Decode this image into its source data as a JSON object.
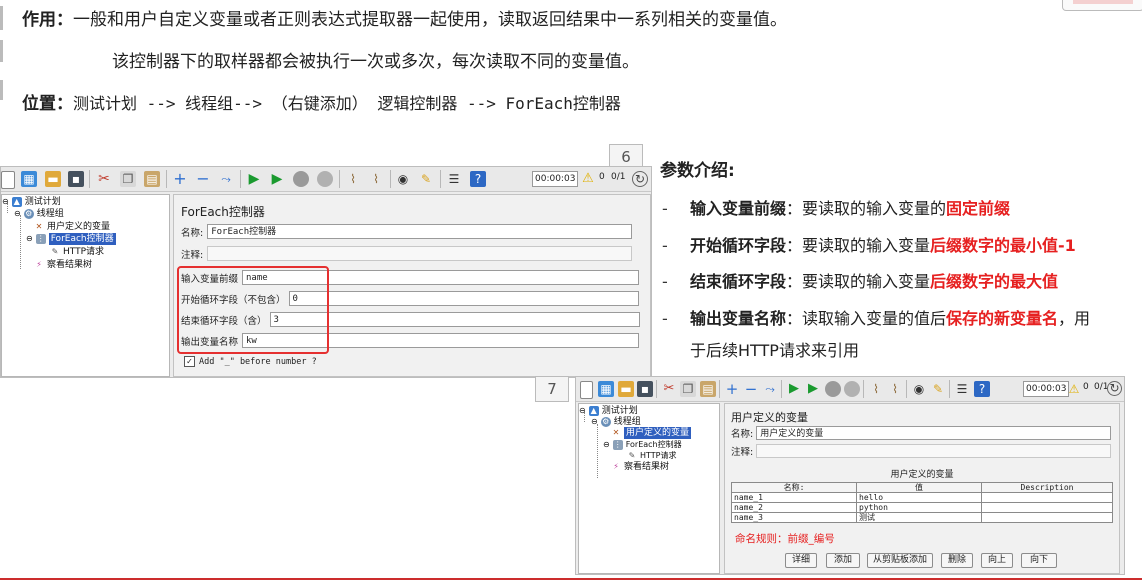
{
  "doc": {
    "purpose_label": "作用",
    "purpose_text": "一般和用户自定义变量或者正则表达式提取器一起使用，读取返回结果中一系列相关的变量值。",
    "purpose_text2": "该控制器下的取样器都会被执行一次或多次，每次读取不同的变量值。",
    "position_label": "位置",
    "position_text": "测试计划 --> 线程组--> （右键添加） 逻辑控制器 -->  ForEach控制器"
  },
  "screenshot6": {
    "tag": "6",
    "timer": "00:00:03",
    "warn_count": "0",
    "threads": "0/1",
    "tree": {
      "test_plan": "测试计划",
      "thread_group": "线程组",
      "user_vars": "用户定义的变量",
      "foreach": "ForEach控制器",
      "http": "HTTP请求",
      "result_tree": "察看结果树"
    },
    "panel": {
      "title": "ForEach控制器",
      "name_label": "名称:",
      "name_value": "ForEach控制器",
      "comment_label": "注释:",
      "input_prefix_label": "输入变量前缀",
      "input_prefix_value": "name",
      "start_label": "开始循环字段（不包含）",
      "start_value": "0",
      "end_label": "结束循环字段（含）",
      "end_value": "3",
      "output_label": "输出变量名称",
      "output_value": "kw",
      "add_label": "Add \"_\" before number ?",
      "add_checked": "✓"
    }
  },
  "params": {
    "heading": "参数介绍:",
    "items": [
      {
        "dash": "-",
        "label": "输入变量前缀",
        "text": "：要读取的输入变量的",
        "highlight": "固定前缀",
        "tail": ""
      },
      {
        "dash": "-",
        "label": "开始循环字段",
        "text": "：要读取的输入变量",
        "highlight": "后缀数字的最小值-1",
        "tail": ""
      },
      {
        "dash": "-",
        "label": "结束循环字段",
        "text": "：要读取的输入变量",
        "highlight": "后缀数字的最大值",
        "tail": ""
      },
      {
        "dash": "-",
        "label": "输出变量名称",
        "text": "：读取输入变量的值后",
        "highlight": "保存的新变量名",
        "tail": "，用"
      }
    ],
    "continuation": "于后续HTTP请求来引用"
  },
  "screenshot7": {
    "tag": "7",
    "timer": "00:00:03",
    "warn_count": "0",
    "threads": "0/1",
    "tree": {
      "test_plan": "测试计划",
      "thread_group": "线程组",
      "user_vars": "用户定义的变量",
      "foreach": "ForEach控制器",
      "http": "HTTP请求",
      "result_tree": "察看结果树"
    },
    "panel": {
      "title": "用户定义的变量",
      "name_label": "名称:",
      "name_value": "用户定义的变量",
      "comment_label": "注释:",
      "table_caption": "用户定义的变量",
      "columns": [
        "名称:",
        "值",
        "Description"
      ],
      "rows": [
        [
          "name_1",
          "hello",
          ""
        ],
        [
          "name_2",
          "python",
          ""
        ],
        [
          "name_3",
          "测试",
          ""
        ]
      ],
      "naming_rule": "命名规则：前缀_编号",
      "buttons": [
        "详细",
        "添加",
        "从剪贴板添加",
        "删除",
        "向上",
        "向下"
      ]
    }
  }
}
